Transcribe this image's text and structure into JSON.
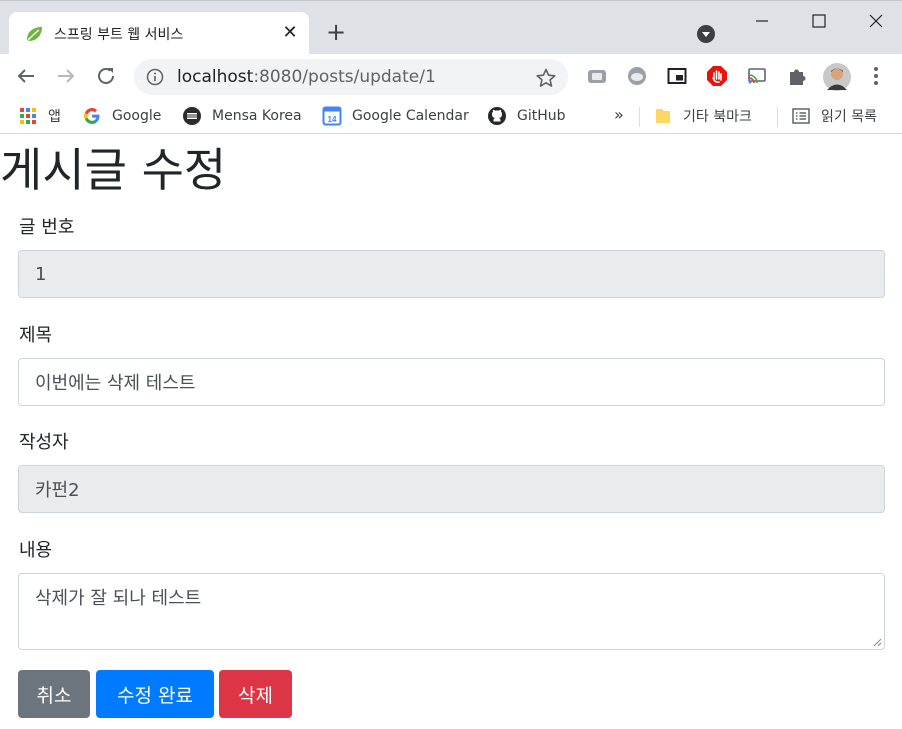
{
  "colors": {
    "titlebar_bg": "#dee1e6",
    "btn_secondary": "#6c757d",
    "btn_primary": "#007bff",
    "btn_danger": "#dc3545",
    "readonly_bg": "#e9ecef"
  },
  "browser": {
    "tab": {
      "title": "스프링 부트 웹 서비스",
      "favicon": "spring-leaf-icon",
      "close": "✕"
    },
    "new_tab": "+",
    "url": {
      "host": "localhost",
      "rest": ":8080/posts/update/1"
    },
    "extensions": [
      "extension-1-icon",
      "extension-2-icon",
      "picture-in-picture-icon",
      "adblock-icon",
      "cast-icon",
      "puzzle-icon",
      "profile-avatar"
    ]
  },
  "bookmarks": {
    "items": [
      {
        "label": "앱",
        "icon": "apps-grid-icon"
      },
      {
        "label": "Google",
        "icon": "google-icon"
      },
      {
        "label": "Mensa Korea",
        "icon": "mensa-icon"
      },
      {
        "label": "Google Calendar",
        "icon": "calendar-icon"
      },
      {
        "label": "GitHub",
        "icon": "github-icon"
      }
    ],
    "more": "»",
    "other": "기타 북마크",
    "reading_list": "읽기 목록"
  },
  "page": {
    "title": "게시글 수정",
    "fields": {
      "id": {
        "label": "글 번호",
        "value": "1"
      },
      "title": {
        "label": "제목",
        "value": "이번에는 삭제 테스트"
      },
      "author": {
        "label": "작성자",
        "value": "카펀2"
      },
      "content": {
        "label": "내용",
        "value": "삭제가 잘 되나 테스트"
      }
    },
    "buttons": {
      "cancel": "취소",
      "update": "수정 완료",
      "delete": "삭제"
    }
  }
}
